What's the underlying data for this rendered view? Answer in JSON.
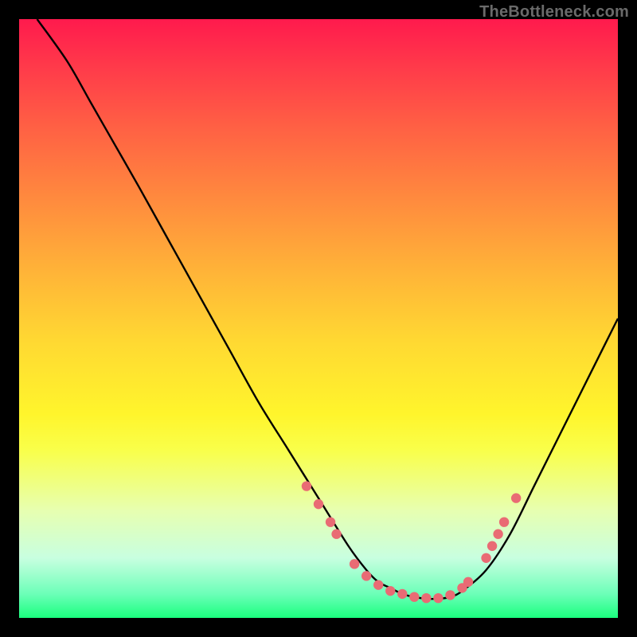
{
  "attribution": "TheBottleneck.com",
  "chart_data": {
    "type": "line",
    "title": "",
    "xlabel": "",
    "ylabel": "",
    "xlim": [
      0,
      100
    ],
    "ylim": [
      0,
      100
    ],
    "series": [
      {
        "name": "curve",
        "x": [
          3,
          8,
          12,
          16,
          20,
          25,
          30,
          35,
          40,
          45,
          50,
          55,
          58,
          60,
          62,
          64,
          66,
          68,
          70,
          72,
          74,
          78,
          82,
          86,
          90,
          94,
          98,
          100
        ],
        "y": [
          100,
          93,
          86,
          79,
          72,
          63,
          54,
          45,
          36,
          28,
          20,
          12,
          8,
          6,
          5,
          4,
          3.5,
          3.2,
          3.2,
          3.5,
          4.5,
          8,
          14,
          22,
          30,
          38,
          46,
          50
        ]
      }
    ],
    "markers": [
      {
        "x": 48,
        "y": 22
      },
      {
        "x": 50,
        "y": 19
      },
      {
        "x": 52,
        "y": 16
      },
      {
        "x": 53,
        "y": 14
      },
      {
        "x": 56,
        "y": 9
      },
      {
        "x": 58,
        "y": 7
      },
      {
        "x": 60,
        "y": 5.5
      },
      {
        "x": 62,
        "y": 4.5
      },
      {
        "x": 64,
        "y": 4
      },
      {
        "x": 66,
        "y": 3.5
      },
      {
        "x": 68,
        "y": 3.3
      },
      {
        "x": 70,
        "y": 3.3
      },
      {
        "x": 72,
        "y": 3.8
      },
      {
        "x": 74,
        "y": 5
      },
      {
        "x": 75,
        "y": 6
      },
      {
        "x": 78,
        "y": 10
      },
      {
        "x": 79,
        "y": 12
      },
      {
        "x": 80,
        "y": 14
      },
      {
        "x": 81,
        "y": 16
      },
      {
        "x": 83,
        "y": 20
      }
    ],
    "colors": {
      "curve": "#000000",
      "markers": "#e96b74"
    }
  }
}
